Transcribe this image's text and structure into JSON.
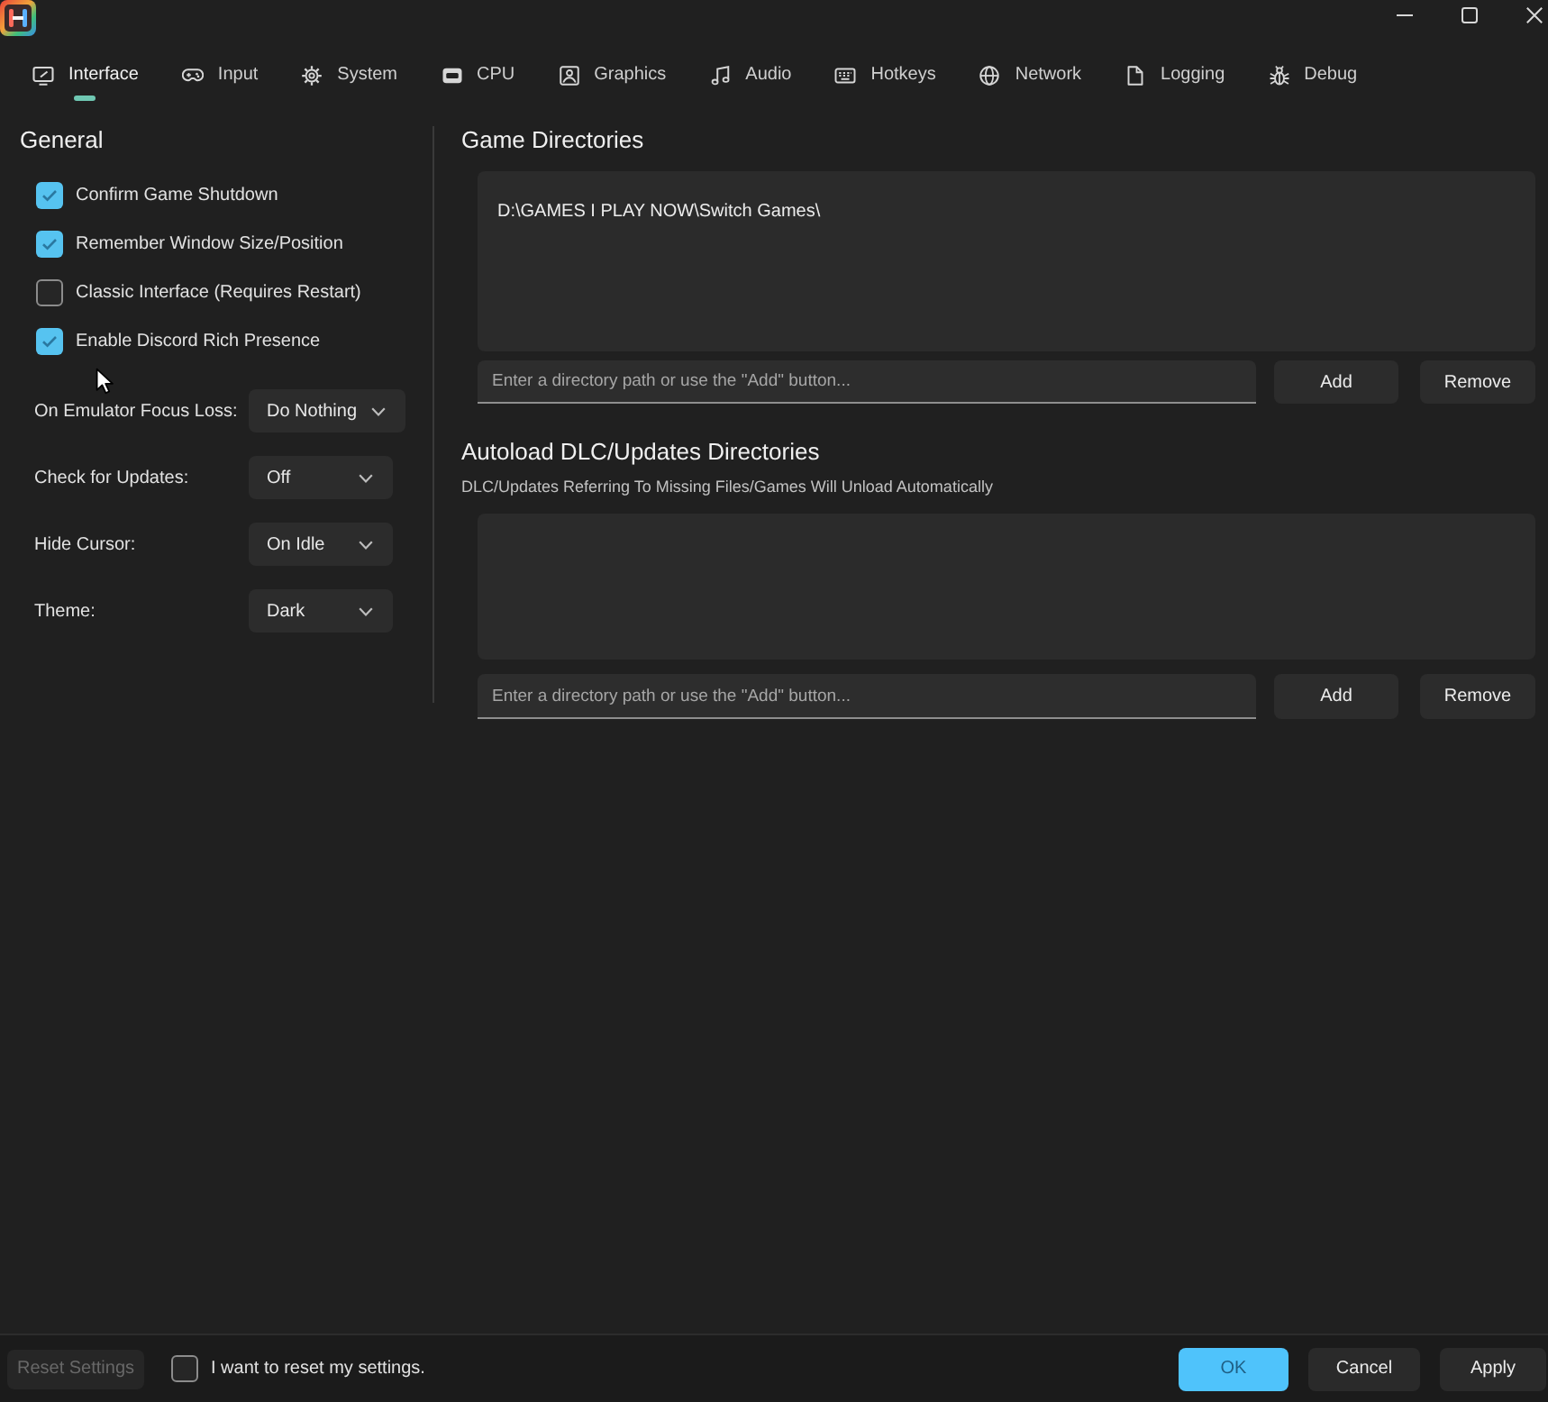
{
  "tabs": [
    {
      "label": "Interface",
      "selected": true
    },
    {
      "label": "Input",
      "selected": false
    },
    {
      "label": "System",
      "selected": false
    },
    {
      "label": "CPU",
      "selected": false
    },
    {
      "label": "Graphics",
      "selected": false
    },
    {
      "label": "Audio",
      "selected": false
    },
    {
      "label": "Hotkeys",
      "selected": false
    },
    {
      "label": "Network",
      "selected": false
    },
    {
      "label": "Logging",
      "selected": false
    },
    {
      "label": "Debug",
      "selected": false
    }
  ],
  "general": {
    "title": "General",
    "options": [
      {
        "label": "Confirm Game Shutdown",
        "checked": true
      },
      {
        "label": "Remember Window Size/Position",
        "checked": true
      },
      {
        "label": "Classic Interface (Requires Restart)",
        "checked": false
      },
      {
        "label": "Enable Discord Rich Presence",
        "checked": true
      }
    ],
    "settings": [
      {
        "label": "On Emulator Focus Loss:",
        "value": "Do Nothing"
      },
      {
        "label": "Check for Updates:",
        "value": "Off"
      },
      {
        "label": "Hide Cursor:",
        "value": "On Idle"
      },
      {
        "label": "Theme:",
        "value": "Dark"
      }
    ]
  },
  "game_directories": {
    "title": "Game Directories",
    "entries": [
      "D:\\GAMES I PLAY NOW\\Switch Games\\"
    ],
    "path_field": {
      "placeholder": "Enter a directory path or use the \"Add\" button..."
    },
    "buttons": [
      "Add",
      "Remove"
    ]
  },
  "autoload_directories": {
    "title": "Autoload DLC/Updates Directories",
    "subtitle": "DLC/Updates Referring To Missing Files/Games Will Unload Automatically",
    "path_field": {
      "placeholder": "Enter a directory path or use the \"Add\" button..."
    },
    "buttons": [
      "Add",
      "Remove"
    ]
  },
  "footer": {
    "reset_button": {
      "label": "Reset Settings",
      "disabled": true
    },
    "reset_confirm": {
      "label": "I want to reset my settings.",
      "checked": false
    },
    "buttons": [
      {
        "label": "OK",
        "kind": "accent"
      },
      {
        "label": "Cancel",
        "kind": "standard"
      },
      {
        "label": "Apply",
        "kind": "standard"
      }
    ]
  }
}
